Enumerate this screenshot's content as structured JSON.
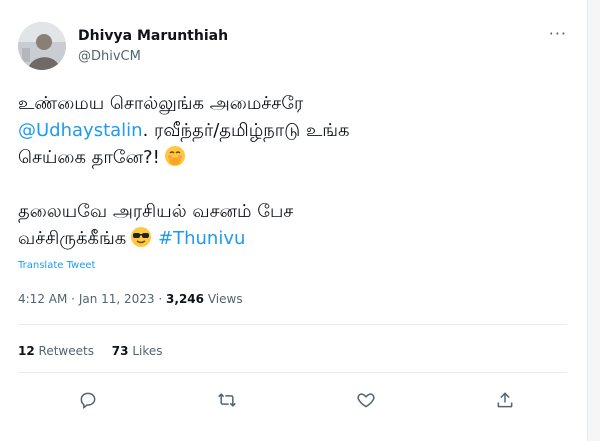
{
  "author": {
    "display_name": "Dhivya Marunthiah",
    "handle": "@DhivCM",
    "avatar_icon": "avatar",
    "more_icon": "more-horizontal-icon",
    "more_label": "···"
  },
  "tweet": {
    "line1": "உண்மைய சொல்லுங்க அமைச்சரே",
    "mention": "@Udhaystalin",
    "line2_rest": ". ரவீந்தர்/தமிழ்நாடு உங்க",
    "line3": "செய்கை தானே?!",
    "line3_emoji": "face-with-hand-over-mouth",
    "line4": "தலையவே அரசியல் வசனம் பேச",
    "line5": "வச்சிருக்கீங்க",
    "line5_emoji": "smiling-face-with-sunglasses",
    "hashtag": "#Thunivu"
  },
  "translate_label": "Translate Tweet",
  "meta": {
    "time": "4:12 AM",
    "dot": "·",
    "date": "Jan 11, 2023",
    "views_count": "3,246",
    "views_label": "Views"
  },
  "stats": {
    "retweets_count": "12",
    "retweets_label": "Retweets",
    "likes_count": "73",
    "likes_label": "Likes"
  },
  "actions": [
    {
      "name": "reply-icon"
    },
    {
      "name": "retweet-icon"
    },
    {
      "name": "like-icon"
    },
    {
      "name": "share-icon"
    }
  ],
  "colors": {
    "link": "#1d9bf0",
    "text": "#0f1419",
    "muted": "#536471",
    "divider": "#e6ecf0"
  }
}
